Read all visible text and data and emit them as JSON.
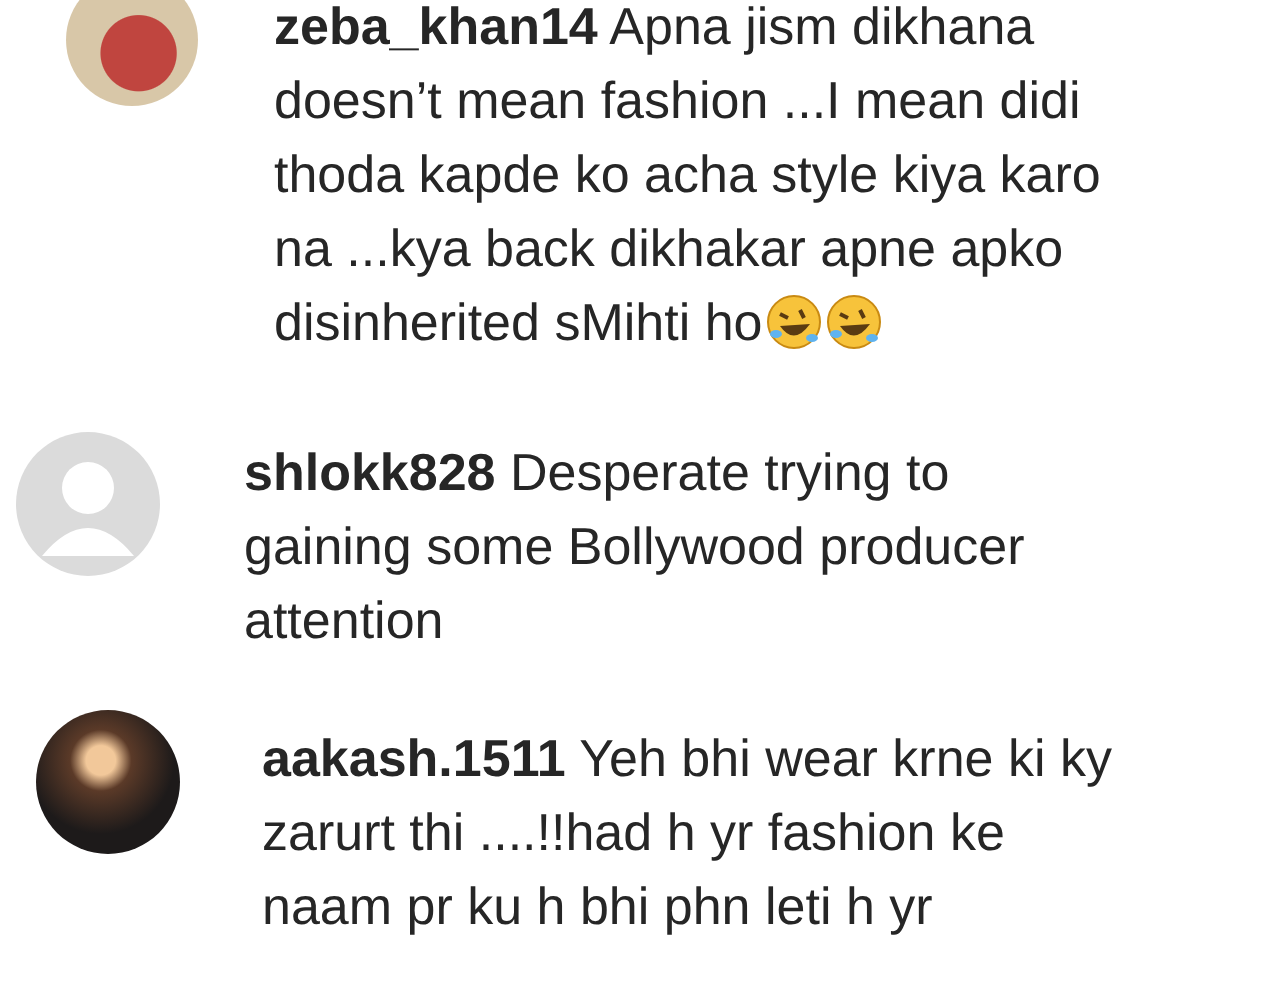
{
  "comments": [
    {
      "username": "zeba_khan14",
      "avatar": {
        "kind": "photo"
      },
      "lines": [
        "Apna jism dikhana",
        "doesn’t mean fashion ...I mean didi",
        "thoda kapde ko acha style kiya karo",
        "na ...kya back dikhakar apne apko",
        "disinherited sMihti ho"
      ],
      "end_icons": [
        {
          "kind": "rolling-laugh"
        },
        {
          "kind": "rolling-laugh"
        }
      ]
    },
    {
      "username": "shlokk828",
      "avatar": {
        "kind": "default"
      },
      "lines": [
        "Desperate trying to",
        "gaining some Bollywood producer",
        "attention"
      ]
    },
    {
      "username": "aakash.1511",
      "avatar": {
        "kind": "photo-dark"
      },
      "lines": [
        "Yeh bhi wear krne ki ky",
        "zarurt thi ....!!had h yr fashion ke",
        "naam pr ku h bhi phn leti h yr"
      ]
    }
  ]
}
